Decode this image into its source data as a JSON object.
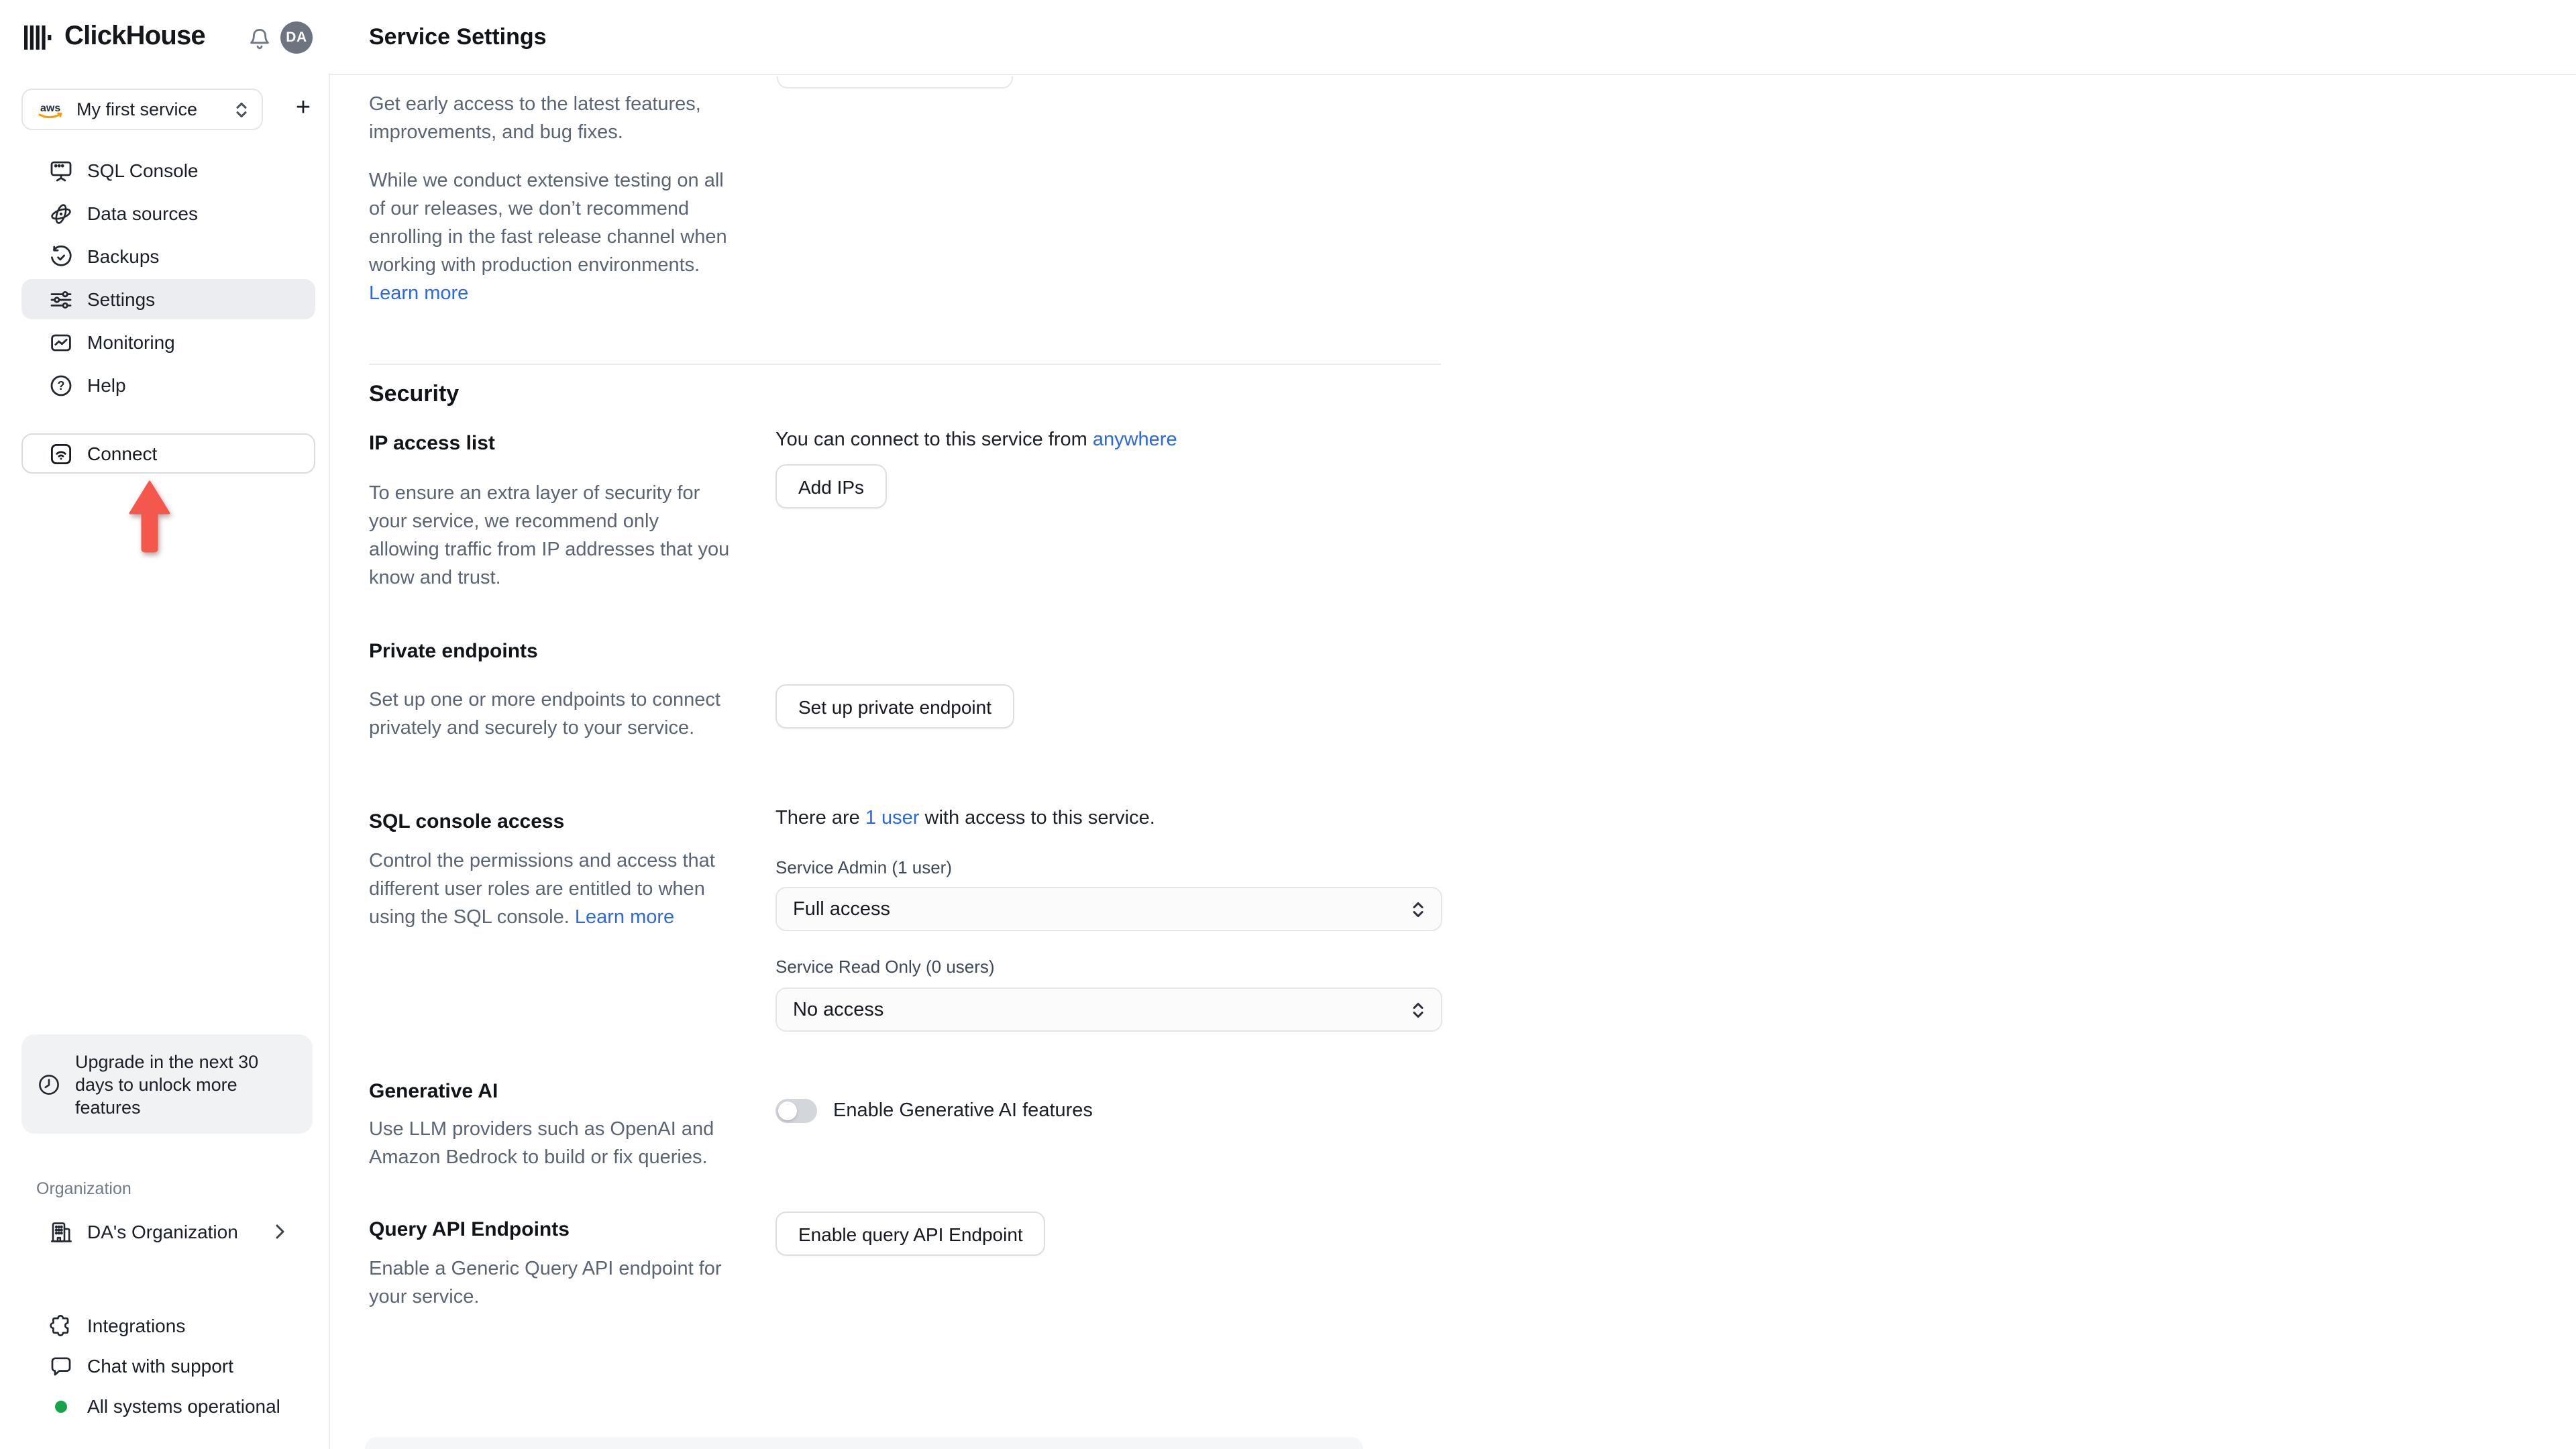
{
  "brand": {
    "name": "ClickHouse",
    "avatar_initials": "DA"
  },
  "service_selector": {
    "label": "My first service",
    "provider_icon_text": "aws"
  },
  "icons": {
    "plus": "+",
    "question": "?"
  },
  "sidebar": {
    "nav": [
      {
        "label": "SQL Console"
      },
      {
        "label": "Data sources"
      },
      {
        "label": "Backups"
      },
      {
        "label": "Settings"
      },
      {
        "label": "Monitoring"
      },
      {
        "label": "Help"
      }
    ],
    "connect_label": "Connect",
    "upgrade_note": "Upgrade in the next 30 days to unlock more features",
    "organization_label": "Organization",
    "organization_name": "DA's Organization",
    "footer": {
      "integrations": "Integrations",
      "chat": "Chat with support",
      "status": "All systems operational"
    }
  },
  "header": {
    "title": "Service Settings"
  },
  "release": {
    "p1": "Get early access to the latest features, improvements, and bug fixes.",
    "p2": "While we conduct extensive testing on all of our releases, we don’t recommend enrolling in the fast release channel when working with production environments. ",
    "learn_more": "Learn more"
  },
  "security": {
    "title": "Security",
    "ip_access": {
      "title": "IP access list",
      "connect_prefix": "You can connect to this service from ",
      "connect_link": "anywhere",
      "button": "Add IPs",
      "description": "To ensure an extra layer of security for your service, we recommend only allowing traffic from IP addresses that you know and trust."
    },
    "private_endpoints": {
      "title": "Private endpoints",
      "description": "Set up one or more endpoints to connect privately and securely to your service.",
      "button": "Set up private endpoint"
    },
    "sql_access": {
      "title": "SQL console access",
      "users_prefix": "There are ",
      "users_link": "1 user",
      "users_suffix": " with access to this service.",
      "description": "Control the permissions and access that different user roles are entitled to when using the SQL console. ",
      "learn_more": "Learn more",
      "admin_label": "Service Admin (1 user)",
      "admin_value": "Full access",
      "readonly_label": "Service Read Only (0 users)",
      "readonly_value": "No access"
    },
    "generative_ai": {
      "title": "Generative AI",
      "description": "Use LLM providers such as OpenAI and Amazon Bedrock to build or fix queries.",
      "toggle_label": "Enable Generative AI features"
    },
    "query_api": {
      "title": "Query API Endpoints",
      "description": "Enable a Generic Query API endpoint for your service.",
      "button": "Enable query API Endpoint"
    }
  },
  "colors": {
    "link_blue": "#2c68e6",
    "arrow_red": "#f4584c",
    "status_green": "#18a34b",
    "avatar_bg": "#6c7480",
    "aws_orange": "#ff9900"
  }
}
